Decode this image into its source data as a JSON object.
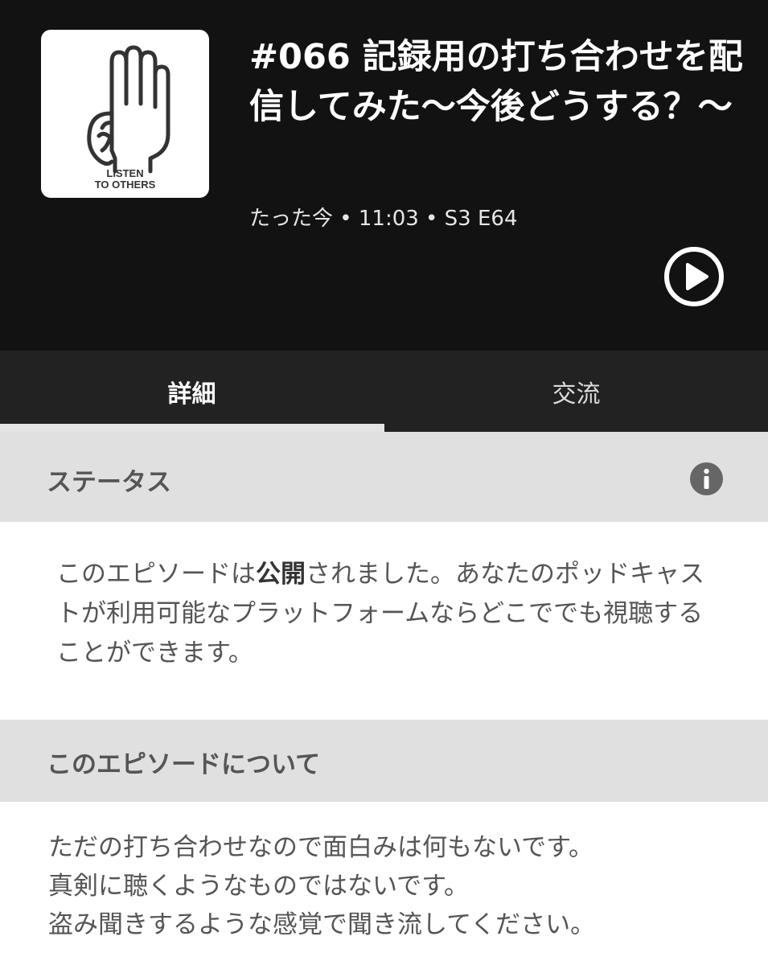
{
  "episode": {
    "cover": {
      "icon": "hand-ear-icon",
      "line1": "LISTEN",
      "line2": "TO OTHERS"
    },
    "title": "#066 記録用の打ち合わせを配信してみた〜今後どうする？〜",
    "meta": "たった今 • 11:03 • S3 E64",
    "play_icon": "play-icon"
  },
  "tabs": [
    {
      "label": "詳細",
      "active": true
    },
    {
      "label": "交流",
      "active": false
    }
  ],
  "status_section": {
    "heading": "ステータス",
    "info_icon": "info-icon",
    "text_before": "このエピソードは",
    "text_bold": "公開",
    "text_after": "されました。あなたのポッドキャストが利用可能なプラットフォームならどこででも視聴することができます。"
  },
  "about_section": {
    "heading": "このエピソードについて",
    "lines": [
      "ただの打ち合わせなので面白みは何もないです。",
      "真剣に聴くようなものではないです。",
      "盗み聞きするような感覚で聞き流してください。"
    ]
  },
  "colors": {
    "header_bg": "#121212",
    "tab_bar_bg": "#222222",
    "section_bg": "#e0e0e0",
    "text_gray": "#555555"
  }
}
